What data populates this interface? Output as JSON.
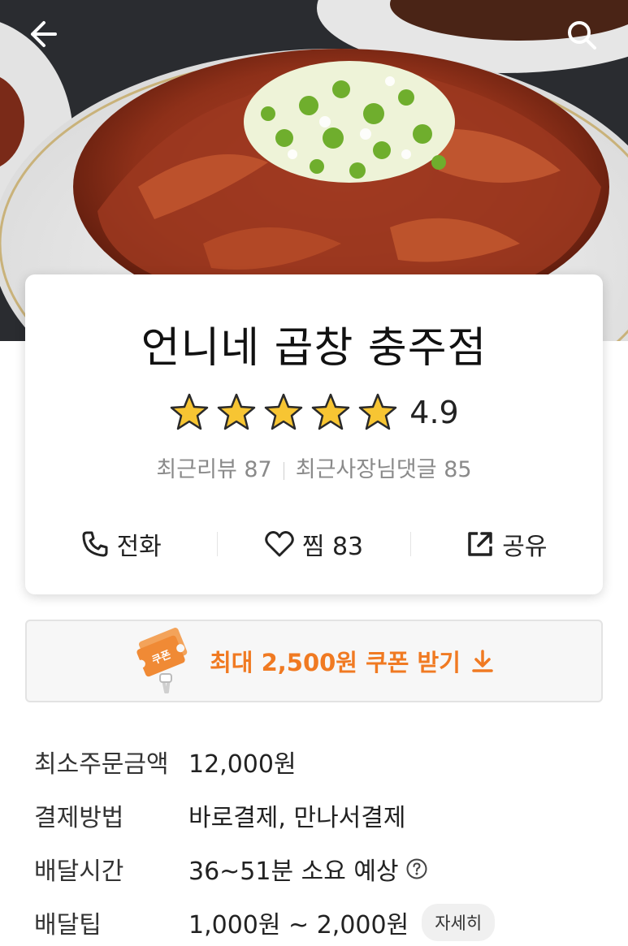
{
  "header": {
    "back_icon": "arrow-left-icon",
    "search_icon": "search-icon"
  },
  "store": {
    "name": "언니네 곱창 충주점",
    "rating": "4.9",
    "stars_filled": 5,
    "recent_reviews": "최근리뷰 87",
    "recent_owner_replies": "최근사장님댓글 85"
  },
  "actions": {
    "call_label": "전화",
    "wish_label": "찜 83",
    "share_label": "공유"
  },
  "coupon": {
    "label": "최대 2,500원 쿠폰 받기",
    "ticket_text": "쿠폰",
    "color": "#f07a22"
  },
  "details": [
    {
      "label": "최소주문금액",
      "value": "12,000원"
    },
    {
      "label": "결제방법",
      "value": "바로결제, 만나서결제"
    },
    {
      "label": "배달시간",
      "value": "36~51분 소요 예상"
    },
    {
      "label": "배달팁",
      "value": "1,000원 ~ 2,000원",
      "button": "자세히"
    }
  ]
}
